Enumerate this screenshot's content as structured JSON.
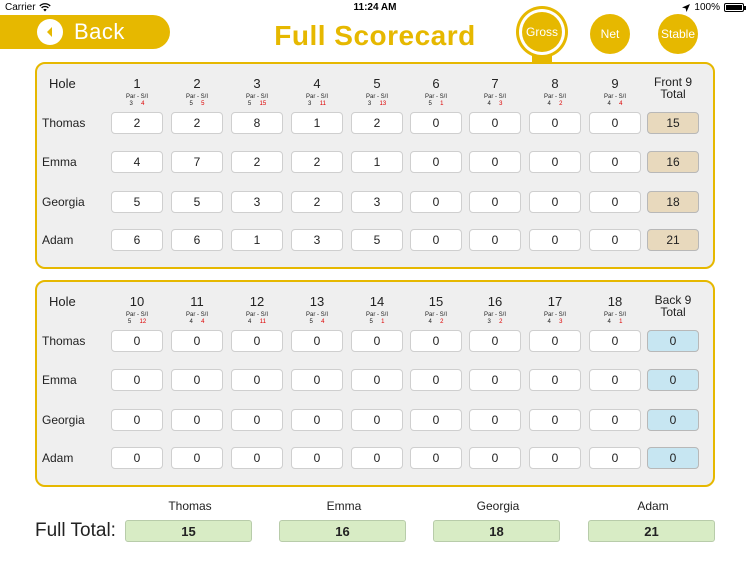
{
  "status": {
    "carrier": "Carrier",
    "time": "11:24 AM",
    "battery": "100%"
  },
  "header": {
    "back_label": "Back",
    "title": "Full Scorecard"
  },
  "modes": [
    {
      "label": "Gross",
      "active": true
    },
    {
      "label": "Net",
      "active": false
    },
    {
      "label": "Stable",
      "active": false
    }
  ],
  "hole_label": "Hole",
  "par_si_label": "Par - S/I",
  "front": {
    "total_label_1": "Front 9",
    "total_label_2": "Total",
    "holes": [
      {
        "num": "1",
        "par": "3",
        "si": "4"
      },
      {
        "num": "2",
        "par": "5",
        "si": "5"
      },
      {
        "num": "3",
        "par": "5",
        "si": "15"
      },
      {
        "num": "4",
        "par": "3",
        "si": "11"
      },
      {
        "num": "5",
        "par": "3",
        "si": "13"
      },
      {
        "num": "6",
        "par": "5",
        "si": "1"
      },
      {
        "num": "7",
        "par": "4",
        "si": "3"
      },
      {
        "num": "8",
        "par": "4",
        "si": "2"
      },
      {
        "num": "9",
        "par": "4",
        "si": "4"
      }
    ],
    "players": [
      {
        "name": "Thomas",
        "scores": [
          "2",
          "2",
          "8",
          "1",
          "2",
          "0",
          "0",
          "0",
          "0"
        ],
        "total": "15"
      },
      {
        "name": "Emma",
        "scores": [
          "4",
          "7",
          "2",
          "2",
          "1",
          "0",
          "0",
          "0",
          "0"
        ],
        "total": "16"
      },
      {
        "name": "Georgia",
        "scores": [
          "5",
          "5",
          "3",
          "2",
          "3",
          "0",
          "0",
          "0",
          "0"
        ],
        "total": "18"
      },
      {
        "name": "Adam",
        "scores": [
          "6",
          "6",
          "1",
          "3",
          "5",
          "0",
          "0",
          "0",
          "0"
        ],
        "total": "21"
      }
    ]
  },
  "back": {
    "total_label_1": "Back 9",
    "total_label_2": "Total",
    "holes": [
      {
        "num": "10",
        "par": "5",
        "si": "12"
      },
      {
        "num": "11",
        "par": "4",
        "si": "4"
      },
      {
        "num": "12",
        "par": "4",
        "si": "11"
      },
      {
        "num": "13",
        "par": "5",
        "si": "4"
      },
      {
        "num": "14",
        "par": "5",
        "si": "1"
      },
      {
        "num": "15",
        "par": "4",
        "si": "2"
      },
      {
        "num": "16",
        "par": "3",
        "si": "2"
      },
      {
        "num": "17",
        "par": "4",
        "si": "3"
      },
      {
        "num": "18",
        "par": "4",
        "si": "1"
      }
    ],
    "players": [
      {
        "name": "Thomas",
        "scores": [
          "0",
          "0",
          "0",
          "0",
          "0",
          "0",
          "0",
          "0",
          "0"
        ],
        "total": "0"
      },
      {
        "name": "Emma",
        "scores": [
          "0",
          "0",
          "0",
          "0",
          "0",
          "0",
          "0",
          "0",
          "0"
        ],
        "total": "0"
      },
      {
        "name": "Georgia",
        "scores": [
          "0",
          "0",
          "0",
          "0",
          "0",
          "0",
          "0",
          "0",
          "0"
        ],
        "total": "0"
      },
      {
        "name": "Adam",
        "scores": [
          "0",
          "0",
          "0",
          "0",
          "0",
          "0",
          "0",
          "0",
          "0"
        ],
        "total": "0"
      }
    ]
  },
  "full_total": {
    "label": "Full Total:",
    "players": [
      {
        "name": "Thomas",
        "total": "15"
      },
      {
        "name": "Emma",
        "total": "16"
      },
      {
        "name": "Georgia",
        "total": "18"
      },
      {
        "name": "Adam",
        "total": "21"
      }
    ]
  },
  "colors": {
    "accent": "#e6b800",
    "front_total": "#e8d9bd",
    "back_total": "#c7e6f2",
    "full_total": "#d8ecc5",
    "stroke_index": "#dd0000"
  }
}
